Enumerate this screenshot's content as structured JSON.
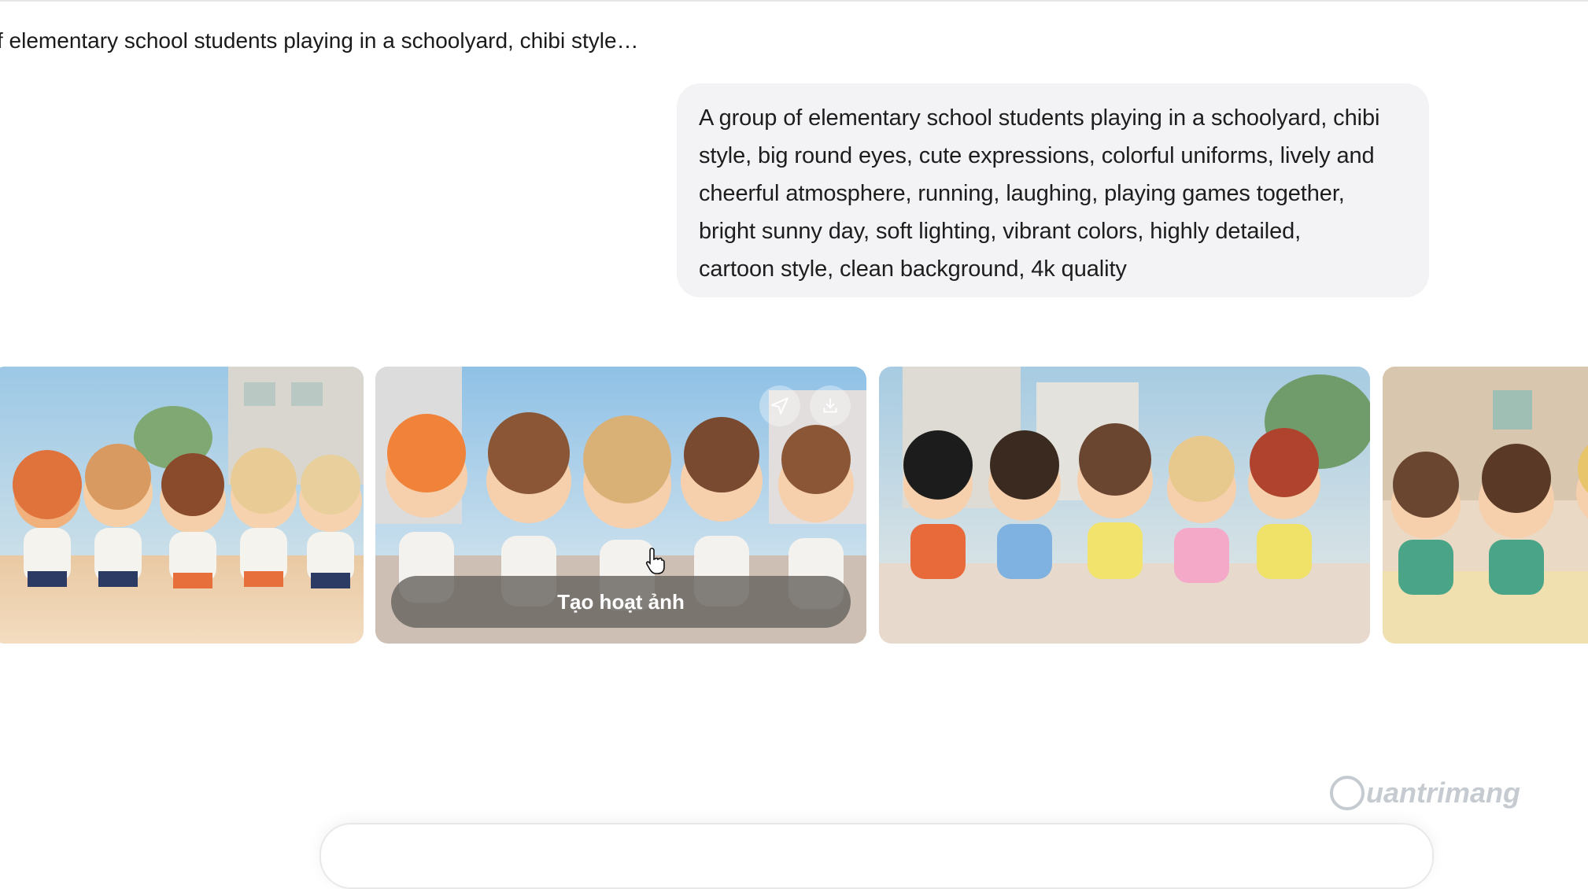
{
  "conversation": {
    "title": "f elementary school students playing in a schoolyard, chibi style…"
  },
  "prompt": {
    "lines": [
      "A group of elementary school students playing in a schoolyard, chibi",
      "style, big round eyes, cute expressions, colorful uniforms, lively and",
      "cheerful atmosphere, running, laughing, playing games together,",
      "bright sunny day, soft lighting, vibrant colors, highly detailed,",
      "cartoon style, clean background, 4k quality"
    ]
  },
  "gallery": {
    "images": [
      {
        "icon": "generated-image"
      },
      {
        "icon": "generated-image",
        "animate_label": "Tạo hoạt ảnh",
        "actions": [
          "share-icon",
          "download-icon"
        ]
      },
      {
        "icon": "generated-image"
      },
      {
        "icon": "generated-image"
      }
    ]
  },
  "watermark": {
    "text": "uantrimang"
  }
}
